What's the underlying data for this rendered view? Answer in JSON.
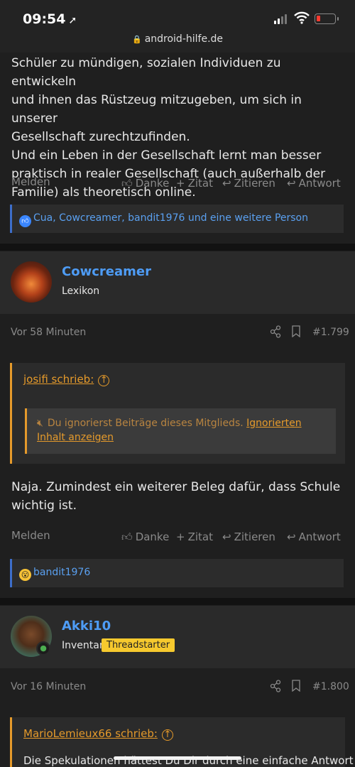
{
  "status": {
    "time": "09:54",
    "url": "android-hilfe.de"
  },
  "post1": {
    "text_lines": [
      "Schüler zu mündigen, sozialen Individuen zu entwickeln",
      "und ihnen das Rüstzeug mitzugeben, um sich in unserer",
      "Gesellschaft zurechtzufinden.",
      "Und ein Leben in der Gesellschaft lernt man besser",
      "praktisch in realer Gesellschaft (auch außerhalb der",
      "Familie) als theoretisch online."
    ],
    "reactions_text": "Cua, Cowcreamer, bandit1976 und eine weitere Person"
  },
  "actions": {
    "report": "Melden",
    "thanks": "Danke",
    "quote_add": "Zitat",
    "cite": "Zitieren",
    "reply": "Antwort"
  },
  "post2": {
    "username": "Cowcreamer",
    "user_title": "Lexikon",
    "time": "Vor 58 Minuten",
    "post_number": "#1.799",
    "quote_author": "josifi schrieb:",
    "ignored_text": "Du ignorierst Beiträge dieses Mitglieds.",
    "ignored_link_1": "Ignorierten Inhalt",
    "ignored_link_2": "anzeigen",
    "text_lines": [
      "Naja. Zumindest ein weiterer Beleg dafür, dass Schule",
      "wichtig ist."
    ],
    "reactions_text": "bandit1976"
  },
  "post3": {
    "username": "Akki10",
    "user_title": "Inventar",
    "badge": "Threadstarter",
    "time": "Vor 16 Minuten",
    "post_number": "#1.800",
    "quote_author": "MarioLemieux66 schrieb:",
    "quote_text": "Die Spekulationen hättest Du Dir durch eine einfache Antwort"
  },
  "colors": {
    "accent_blue": "#4e9cf5",
    "quote_orange": "#e59a2b",
    "badge_yellow": "#f6c92e"
  }
}
